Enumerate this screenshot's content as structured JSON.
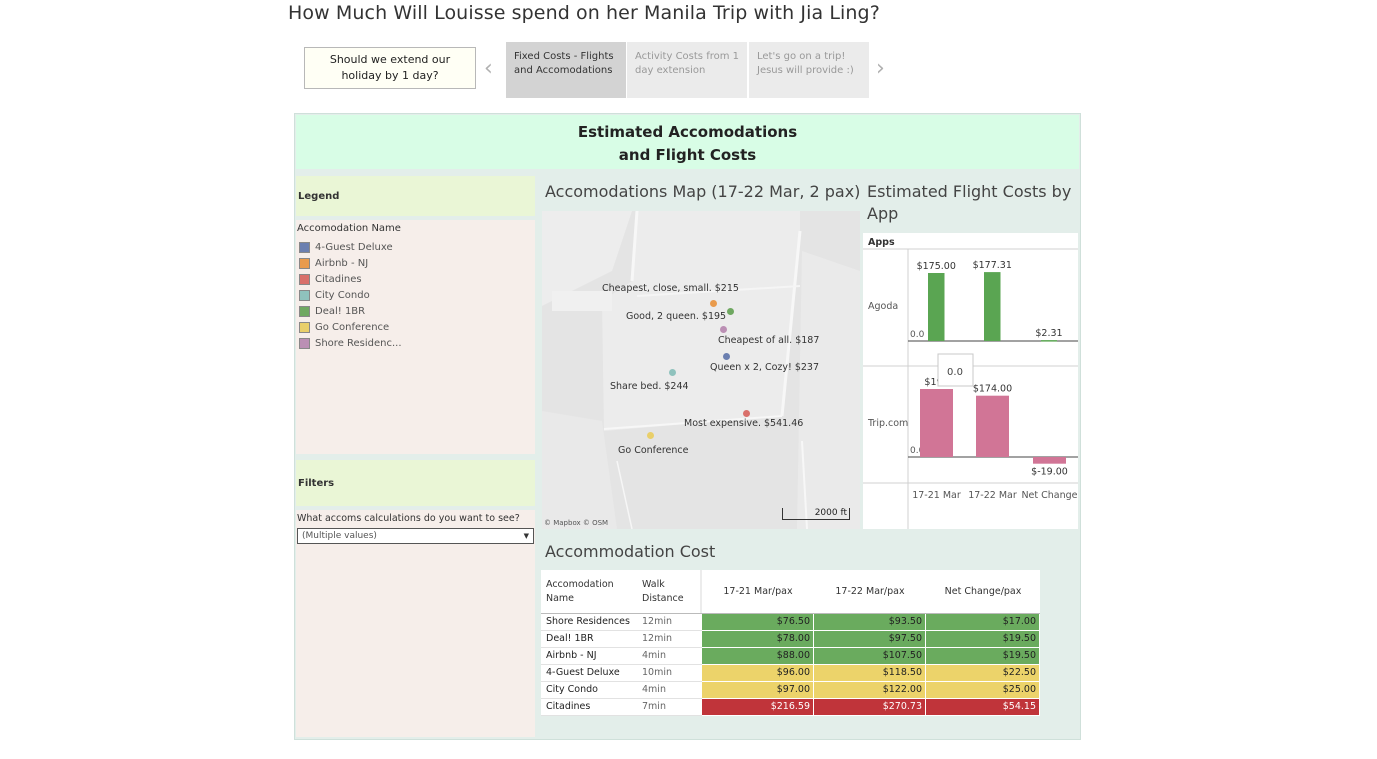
{
  "page": {
    "title": "How Much Will Louisse spend on her Manila Trip with Jia Ling?"
  },
  "story": {
    "caption": "Should we extend our holiday by 1 day?",
    "prev_arrow": "‹",
    "next_arrow": "›",
    "points": [
      {
        "label": "Fixed Costs - Flights and Accomodations",
        "active": true
      },
      {
        "label": "Activity Costs from 1 day extension",
        "active": false
      },
      {
        "label": "Let's go on a trip! Jesus will provide :)",
        "active": false
      }
    ]
  },
  "dashboard": {
    "title_line1": "Estimated Accomodations",
    "title_line2": "and Flight Costs"
  },
  "legend": {
    "header": "Legend",
    "title": "Accomodation Name",
    "items": [
      {
        "label": "4-Guest Deluxe",
        "color": "#6b7fb0"
      },
      {
        "label": "Airbnb - NJ",
        "color": "#e99b4d"
      },
      {
        "label": "Citadines",
        "color": "#d9706b"
      },
      {
        "label": "City Condo",
        "color": "#8fc2bd"
      },
      {
        "label": "Deal! 1BR",
        "color": "#6fa861"
      },
      {
        "label": "Go Conference",
        "color": "#e9cf6a"
      },
      {
        "label": "Shore Residenc...",
        "color": "#bb8fb4"
      }
    ]
  },
  "filters": {
    "header": "Filters",
    "label": "What accoms calculations do you want to see?",
    "value": "(Multiple values)",
    "caret": "▼"
  },
  "map": {
    "title": "Accomodations Map (17-22 Mar, 2 pax)",
    "attribution": "© Mapbox  © OSM",
    "scale": "2000 ft",
    "points": [
      {
        "label": "Cheapest, close, small. $215",
        "color": "#e99b4d"
      },
      {
        "label": "Good, 2 queen. $195",
        "color": "#6fa861"
      },
      {
        "label": "Cheapest of all. $187",
        "color": "#bb8fb4"
      },
      {
        "label": "Queen x 2, Cozy! $237",
        "color": "#6b7fb0"
      },
      {
        "label": "Share bed. $244",
        "color": "#8fc2bd"
      },
      {
        "label": "Most expensive. $541.46",
        "color": "#d9706b"
      },
      {
        "label": "Go Conference",
        "color": "#e9cf6a"
      }
    ]
  },
  "flight": {
    "title": "Estimated Flight Costs by App",
    "apps_header": "Apps",
    "tooltip": "0.0"
  },
  "chart_data": {
    "type": "bar",
    "title": "Estimated Flight Costs by App",
    "categories": [
      "17-21 Mar",
      "17-22 Mar",
      "Net Change"
    ],
    "series": [
      {
        "name": "Agoda",
        "values": [
          175.0,
          177.31,
          2.31
        ],
        "labels": [
          "$175.00",
          "$177.31",
          "$2.31"
        ],
        "color": "#5aa552"
      },
      {
        "name": "Trip.com",
        "values": [
          193.0,
          174.0,
          -19.0
        ],
        "labels": [
          "$193.00",
          "$174.00",
          "$-19.00"
        ],
        "visible_labels": [
          "$193",
          "$174.00",
          "$-19.00"
        ],
        "color": "#d17596"
      }
    ],
    "zero_label": "0.0"
  },
  "accom_cost": {
    "title": "Accommodation Cost",
    "headers": [
      "Accomodation Name",
      "Walk Distance",
      "17-21 Mar/pax",
      "17-22 Mar/pax",
      "Net Change/pax"
    ],
    "rows": [
      {
        "name": "Shore Residences",
        "walk": "12min",
        "v1": "$76.50",
        "v2": "$93.50",
        "v3": "$17.00",
        "color": "#6aab5e"
      },
      {
        "name": "Deal! 1BR",
        "walk": "12min",
        "v1": "$78.00",
        "v2": "$97.50",
        "v3": "$19.50",
        "color": "#6aab5e"
      },
      {
        "name": "Airbnb - NJ",
        "walk": "4min",
        "v1": "$88.00",
        "v2": "$107.50",
        "v3": "$19.50",
        "color": "#6aab5e"
      },
      {
        "name": "4-Guest Deluxe",
        "walk": "10min",
        "v1": "$96.00",
        "v2": "$118.50",
        "v3": "$22.50",
        "color": "#ecd36a"
      },
      {
        "name": "City Condo",
        "walk": "4min",
        "v1": "$97.00",
        "v2": "$122.00",
        "v3": "$25.00",
        "color": "#ecd36a"
      },
      {
        "name": "Citadines",
        "walk": "7min",
        "v1": "$216.59",
        "v2": "$270.73",
        "v3": "$54.15",
        "color": "#c0343a"
      }
    ]
  }
}
